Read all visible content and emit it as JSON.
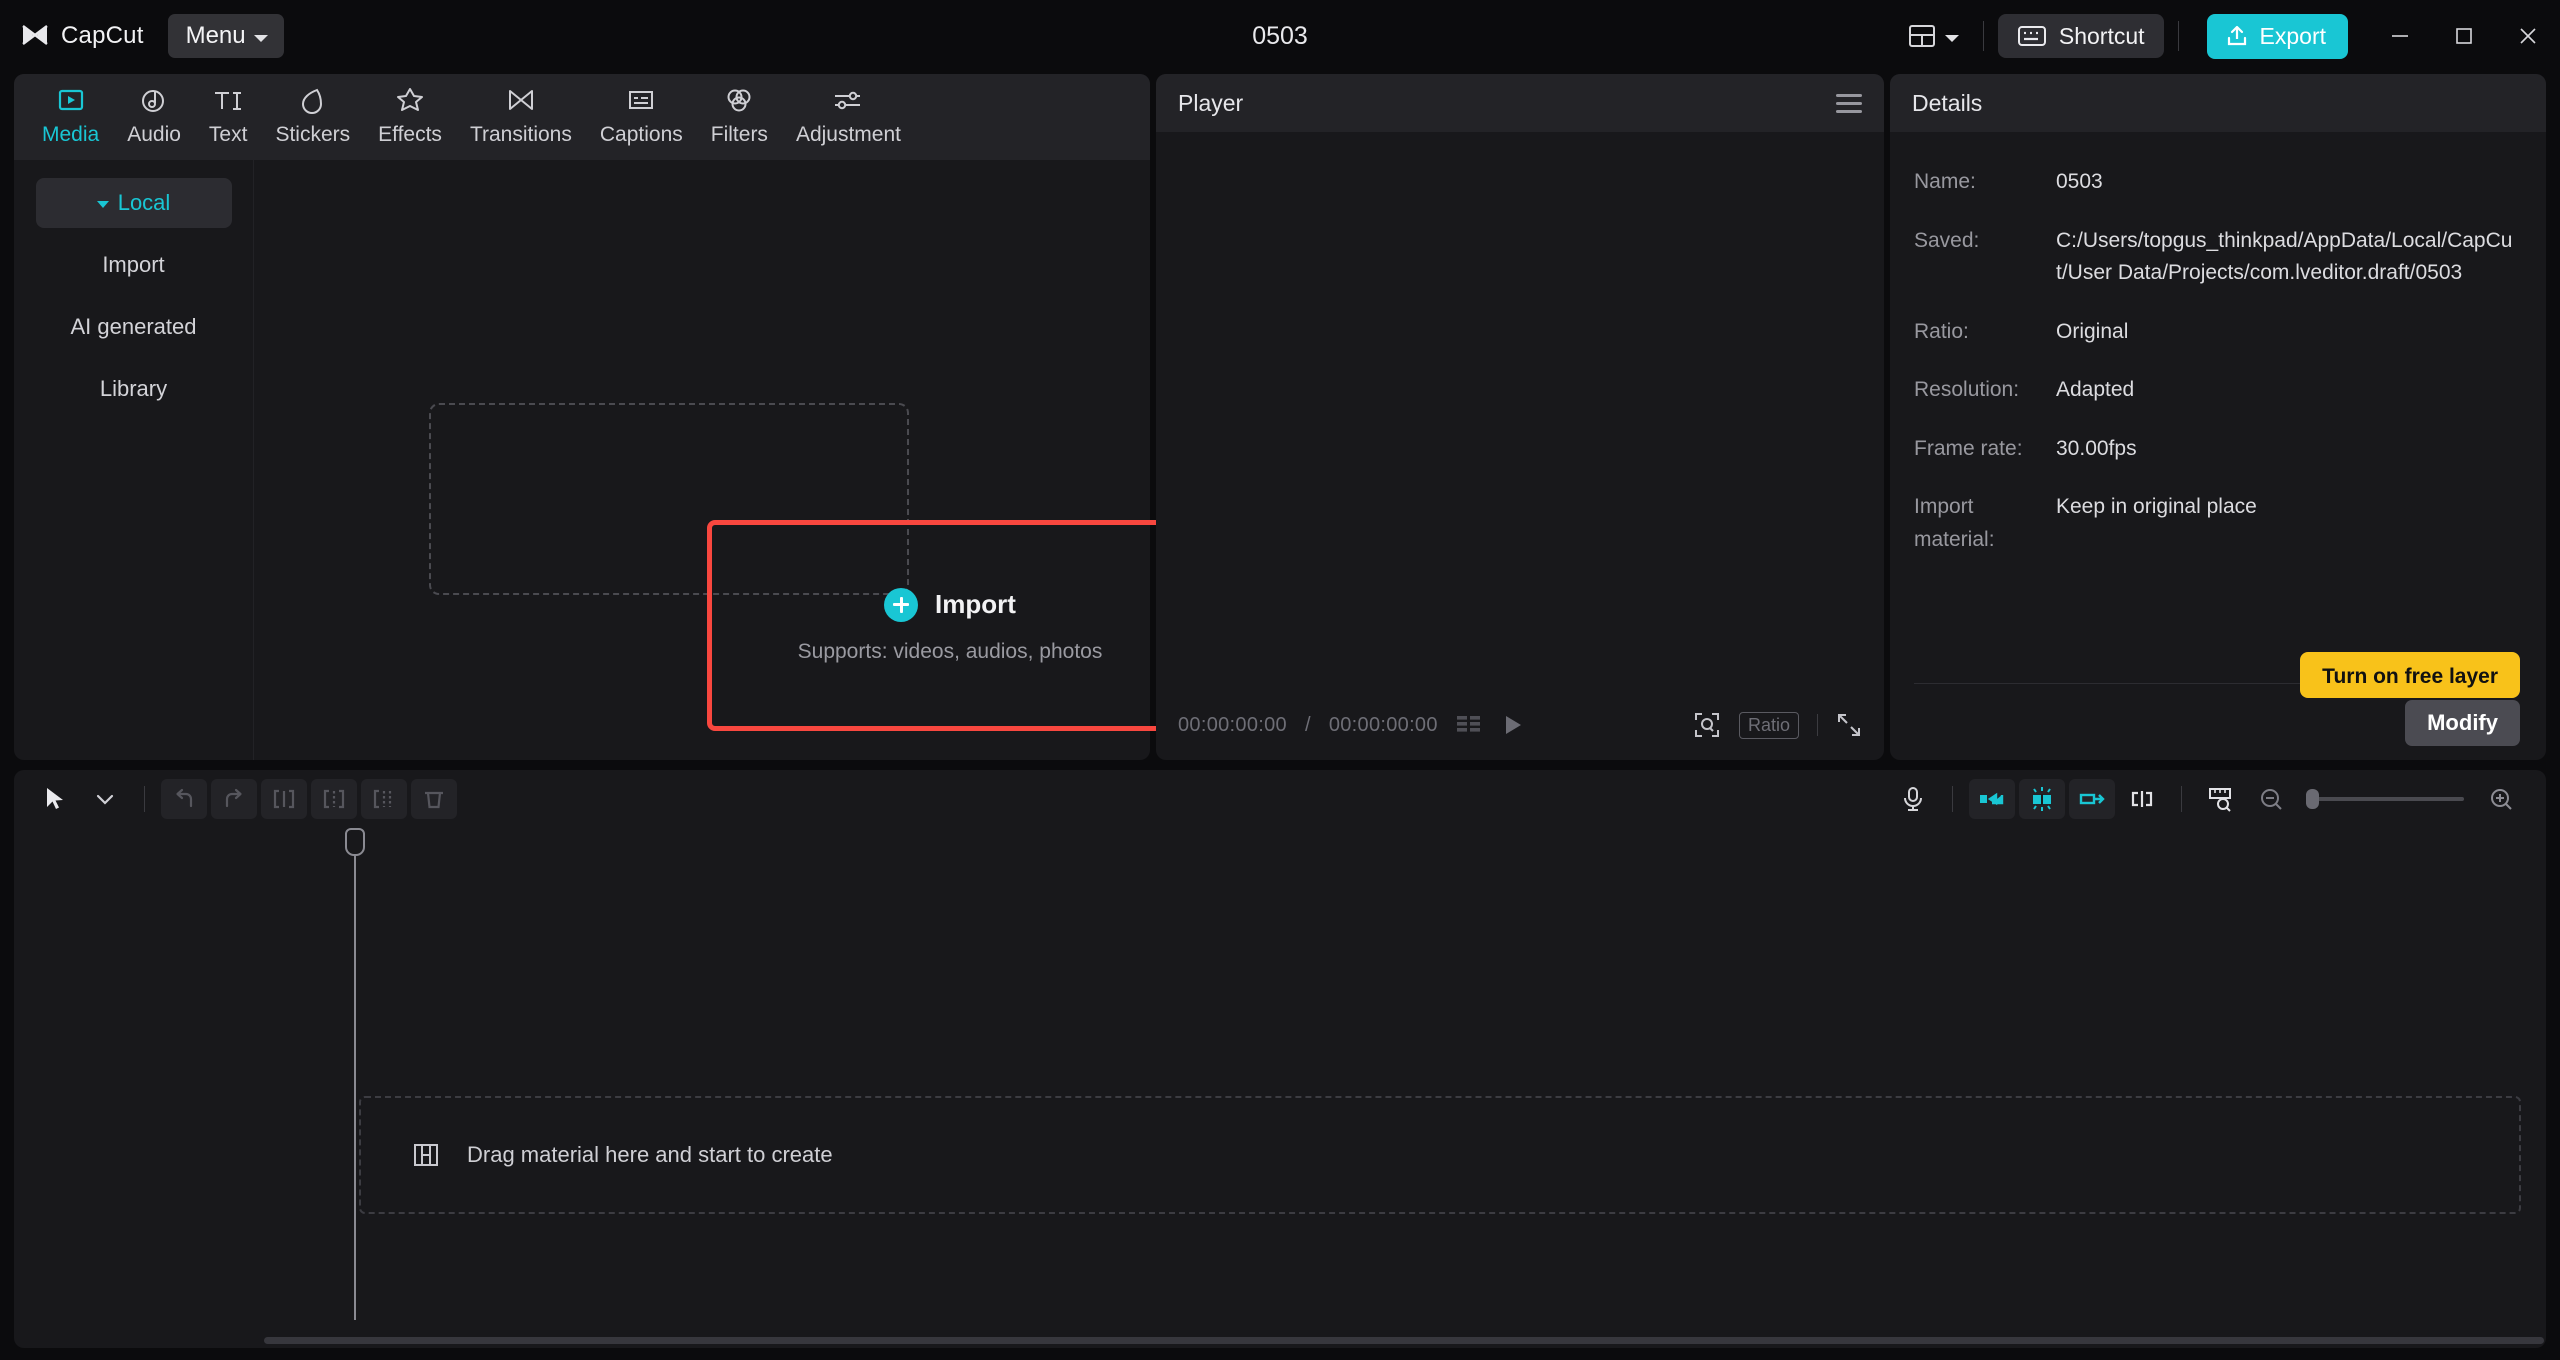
{
  "titlebar": {
    "brand": "CapCut",
    "menu_label": "Menu",
    "project_title": "0503",
    "shortcut_label": "Shortcut",
    "export_label": "Export",
    "layout_icon": "layout-grid-icon",
    "minimize_icon": "minimize-icon",
    "maximize_icon": "maximize-icon",
    "close_icon": "close-icon"
  },
  "tabs": [
    {
      "label": "Media",
      "icon": "media-play-icon",
      "active": true
    },
    {
      "label": "Audio",
      "icon": "audio-note-icon",
      "active": false
    },
    {
      "label": "Text",
      "icon": "text-ti-icon",
      "active": false
    },
    {
      "label": "Stickers",
      "icon": "sticker-drop-icon",
      "active": false
    },
    {
      "label": "Effects",
      "icon": "effects-star-icon",
      "active": false
    },
    {
      "label": "Transitions",
      "icon": "transitions-bowtie-icon",
      "active": false
    },
    {
      "label": "Captions",
      "icon": "captions-box-icon",
      "active": false
    },
    {
      "label": "Filters",
      "icon": "filters-circles-icon",
      "active": false
    },
    {
      "label": "Adjustment",
      "icon": "adjustment-sliders-icon",
      "active": false
    }
  ],
  "media_sidebar": {
    "items": [
      {
        "label": "Local",
        "active": true,
        "expandable": true
      },
      {
        "label": "Import",
        "active": false,
        "expandable": false
      },
      {
        "label": "AI generated",
        "active": false,
        "expandable": false
      },
      {
        "label": "Library",
        "active": false,
        "expandable": false
      }
    ]
  },
  "import_area": {
    "button_label": "Import",
    "supports_text": "Supports: videos, audios, photos",
    "plus_icon": "plus-circle-icon",
    "highlight_color": "#f8473f"
  },
  "player": {
    "title": "Player",
    "menu_icon": "hamburger-icon",
    "current_time": "00:00:00:00",
    "separator": "/",
    "total_time": "00:00:00:00",
    "frames_icon": "frames-grid-icon",
    "play_icon": "play-icon",
    "zoom_fit_icon": "zoom-fit-icon",
    "ratio_label": "Ratio",
    "fullscreen_icon": "fullscreen-icon"
  },
  "details": {
    "title": "Details",
    "rows": [
      {
        "label": "Name:",
        "value": "0503"
      },
      {
        "label": "Saved:",
        "value": "C:/Users/topgus_thinkpad/AppData/Local/CapCut/User Data/Projects/com.lveditor.draft/0503"
      },
      {
        "label": "Ratio:",
        "value": "Original"
      },
      {
        "label": "Resolution:",
        "value": "Adapted"
      },
      {
        "label": "Frame rate:",
        "value": "30.00fps"
      },
      {
        "label": "Import material:",
        "value": "Keep in original place"
      }
    ],
    "free_layer_label": "Turn on free layer",
    "free_layer_color": "#f8c21a",
    "modify_label": "Modify"
  },
  "timeline": {
    "tools": [
      {
        "name": "select-arrow-icon",
        "boxed": false
      },
      {
        "name": "tool-dropdown-caret-icon",
        "boxed": false
      },
      {
        "name": "undo-icon",
        "boxed": true
      },
      {
        "name": "redo-icon",
        "boxed": true
      },
      {
        "name": "split-icon",
        "boxed": true
      },
      {
        "name": "trim-left-icon",
        "boxed": true
      },
      {
        "name": "trim-right-icon",
        "boxed": true
      },
      {
        "name": "delete-icon",
        "boxed": true
      }
    ],
    "right_tools": [
      {
        "name": "microphone-icon",
        "boxed": false
      },
      {
        "name": "mirror-left-icon",
        "boxed": true
      },
      {
        "name": "auto-snap-icon",
        "boxed": true,
        "active": true
      },
      {
        "name": "mirror-right-icon",
        "boxed": true
      },
      {
        "name": "keyframe-icon",
        "boxed": false
      },
      {
        "name": "ruler-zoom-icon",
        "boxed": false
      }
    ],
    "zoom_out_icon": "zoom-out-icon",
    "zoom_in_icon": "zoom-in-icon",
    "drop_hint": "Drag material here and start to create",
    "drop_hint_icon": "filmstrip-icon"
  },
  "colors": {
    "accent": "#19c6d4",
    "panel_bg": "#18181b",
    "header_bg": "#232327",
    "window_bg": "#0b0b0d",
    "highlight_red": "#f8473f",
    "warning_yellow": "#f8c21a"
  }
}
